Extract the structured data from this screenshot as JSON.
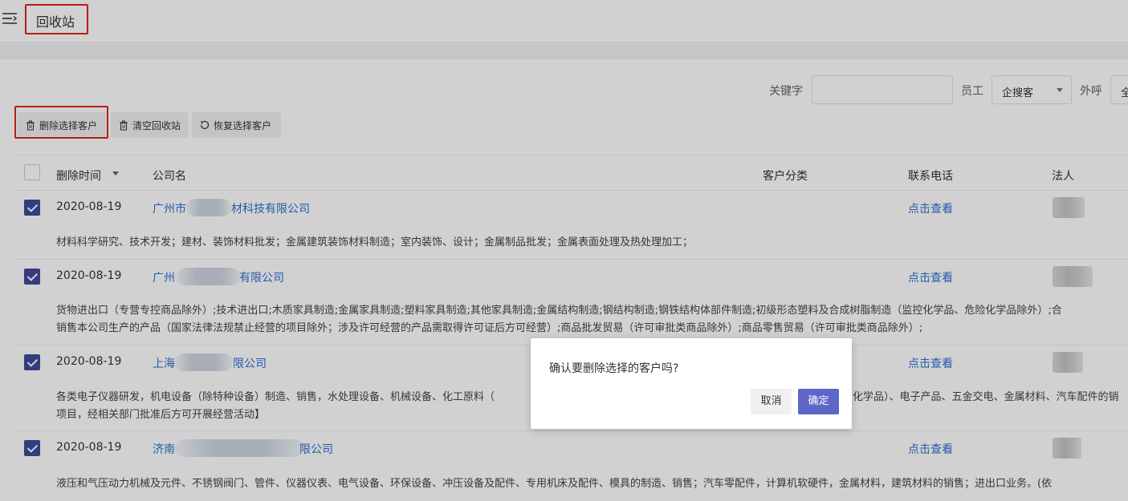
{
  "header": {
    "title": "回收站"
  },
  "filters": {
    "keyword_label": "关键字",
    "keyword_value": "",
    "employee_label": "员工",
    "employee_value": "企搜客",
    "outbound_label": "外呼",
    "outbound_value": "全"
  },
  "toolbar": {
    "delete_selected": "删除选择客户",
    "empty_bin": "清空回收站",
    "restore_selected": "恢复选择客户"
  },
  "table": {
    "columns": [
      "删除时间",
      "公司名",
      "客户分类",
      "联系电话",
      "法人"
    ],
    "rows": [
      {
        "checked": true,
        "date": "2020-08-19",
        "company_prefix": "广州市",
        "company_suffix": "材科技有限公司",
        "phone_link": "点击查看",
        "desc_lines": [
          "材料科学研究、技术开发；建材、装饰材料批发；金属建筑装饰材料制造；室内装饰、设计；金属制品批发；金属表面处理及热处理加工；"
        ]
      },
      {
        "checked": true,
        "date": "2020-08-19",
        "company_prefix": "广州",
        "company_suffix": "有限公司",
        "phone_link": "点击查看",
        "desc_lines": [
          "货物进出口（专营专控商品除外）;技术进出口;木质家具制造;金属家具制造;塑料家具制造;其他家具制造;金属结构制造;钢结构制造;钢铁结构体部件制造;初级形态塑料及合成树脂制造（监控化学品、危险化学品除外）;合",
          "销售本公司生产的产品（国家法律法规禁止经营的项目除外；涉及许可经营的产品需取得许可证后方可经营）;商品批发贸易（许可审批类商品除外）;商品零售贸易（许可审批类商品除外）;"
        ]
      },
      {
        "checked": true,
        "date": "2020-08-19",
        "company_prefix": "上海",
        "company_suffix": "限公司",
        "phone_link": "点击查看",
        "desc_lines": [
          "各类电子仪器研发，机电设备（除特种设备）制造、销售，水处理设备、机械设备、化工原料（",
          "项目，经相关部门批准后方可开展经营活动】"
        ],
        "desc_right": "化学品）、电子产品、五金交电、金属材料、汽车配件的销"
      },
      {
        "checked": true,
        "date": "2020-08-19",
        "company_prefix": "济南",
        "company_suffix": "限公司",
        "phone_link": "点击查看",
        "desc_lines": [
          "液压和气压动力机械及元件、不锈钢阀门、管件、仪器仪表、电气设备、环保设备、冲压设备及配件、专用机床及配件、模具的制造、销售；汽车零配件，计算机软硬件，金属材料，建筑材料的销售；进出口业务。(依"
        ]
      }
    ]
  },
  "dialog": {
    "message": "确认要删除选择的客户吗?",
    "cancel_label": "取消",
    "confirm_label": "确定"
  }
}
